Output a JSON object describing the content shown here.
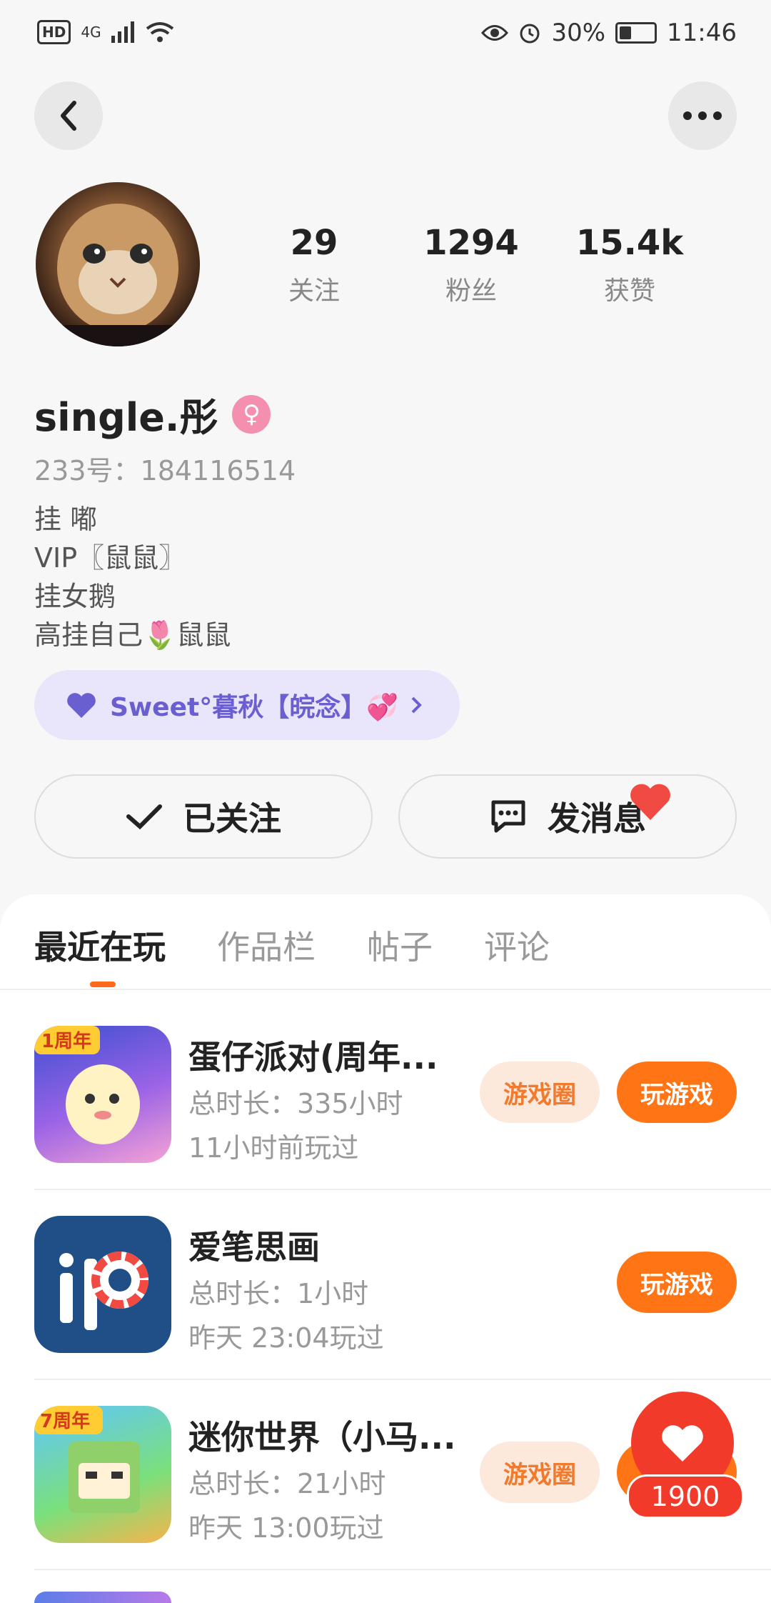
{
  "status_bar": {
    "network": "4G",
    "hd": "HD",
    "battery": "30%",
    "time": "11:46"
  },
  "profile": {
    "stats": [
      {
        "value": "29",
        "label": "关注"
      },
      {
        "value": "1294",
        "label": "粉丝"
      },
      {
        "value": "15.4k",
        "label": "获赞"
      }
    ],
    "name": "single.彤",
    "uid": "233号：184116514",
    "bio": [
      "挂 嘟",
      "VIP〖鼠鼠〗",
      "挂女鹅",
      "高挂自己🌷鼠鼠"
    ],
    "tag": "Sweet°暮秋【皖念】💞",
    "follow_label": "已关注",
    "message_label": "发消息"
  },
  "tabs": [
    "最近在玩",
    "作品栏",
    "帖子",
    "评论"
  ],
  "games": [
    {
      "title": "蛋仔派对(周年...",
      "duration": "总时长：335小时",
      "last": "11小时前玩过",
      "circle_label": "游戏圈",
      "play_label": "玩游戏",
      "badge": "1周年"
    },
    {
      "title": "爱笔思画",
      "duration": "总时长：1小时",
      "last": "昨天 23:04玩过",
      "play_label": "玩游戏"
    },
    {
      "title": "迷你世界（小马...",
      "duration": "总时长：21小时",
      "last": "昨天 13:00玩过",
      "circle_label": "游戏圈",
      "play_label": "玩游戏",
      "badge": "7周年"
    }
  ],
  "floating_like": {
    "count": "1900"
  },
  "colors": {
    "accent": "#ff7515",
    "like": "#f23a2a",
    "tag_bg": "#e9e6fb"
  }
}
